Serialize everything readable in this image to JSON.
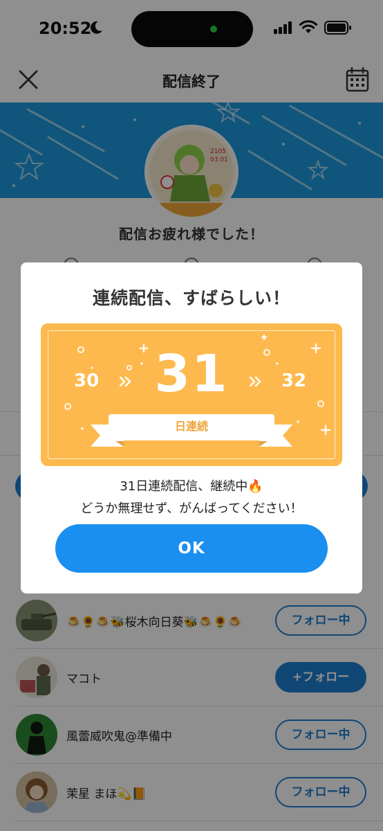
{
  "status_bar": {
    "time": "20:52"
  },
  "nav": {
    "title": "配信終了"
  },
  "stream": {
    "thanks_text": "配信お疲れ様でした！"
  },
  "followers": [
    {
      "name": "🍮🌻🍮🐝桜木向日葵🐝🍮🌻🍮",
      "button": "フォロー中",
      "state": "following"
    },
    {
      "name": "マコト",
      "button": "+フォロー",
      "state": "follow"
    },
    {
      "name": "風蕾威吹鬼@準備中",
      "button": "フォロー中",
      "state": "following"
    },
    {
      "name": "茉星 まほ💫📙",
      "button": "フォロー中",
      "state": "following"
    }
  ],
  "modal": {
    "title": "連続配信、すばらしい！",
    "streak": {
      "previous": "30",
      "current": "31",
      "next": "32",
      "unit": "日連続"
    },
    "message_line1": "31日連続配信、継続中🔥",
    "message_line2": "どうか無理せず、がんばってください！",
    "ok_label": "OK"
  },
  "colors": {
    "banner_blue": "#1e98dc",
    "ticket_orange": "#fdb94d",
    "ok_blue": "#1b8ff0",
    "follow_blue": "#1e7fd0"
  }
}
